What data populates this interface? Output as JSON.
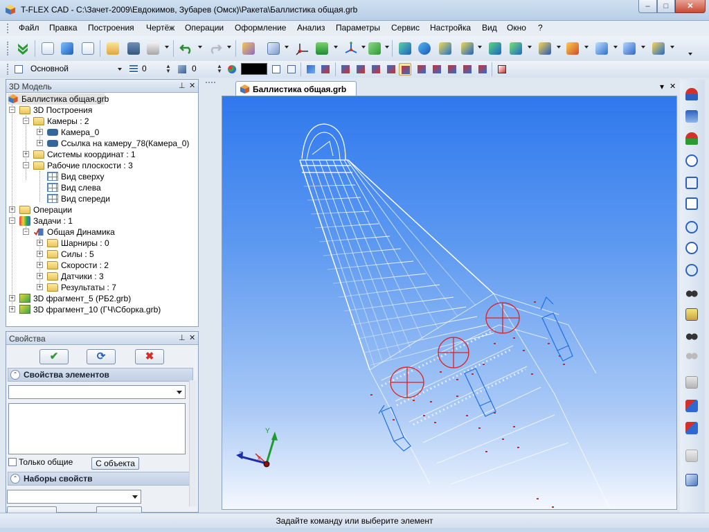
{
  "window": {
    "title": "T-FLEX CAD - C:\\Зачет-2009\\Евдокимов, Зубарев (Омск)\\Ракета\\Баллистика общая.grb",
    "minimize_glyph": "‒",
    "maximize_glyph": "□",
    "close_glyph": "✕"
  },
  "menu": [
    "Файл",
    "Правка",
    "Построения",
    "Чертёж",
    "Операции",
    "Оформление",
    "Анализ",
    "Параметры",
    "Сервис",
    "Настройка",
    "Вид",
    "Окно",
    "?"
  ],
  "toolbar2": {
    "layer_combo": "Основной",
    "level_value": "0",
    "priority_value": "0",
    "color_value": "#000000"
  },
  "model_panel": {
    "title": "3D Модель",
    "pin_glyph": "⊥",
    "close_glyph": "✕",
    "tree": [
      {
        "label": "Баллистика общая.grb",
        "icon": "document-icon"
      },
      {
        "label": "3D Построения",
        "icon": "folder-icon",
        "expander": "−"
      },
      {
        "label": "Камеры : 2",
        "icon": "folder-icon",
        "expander": "−"
      },
      {
        "label": "Камера_0",
        "icon": "camera-icon",
        "expander": "+"
      },
      {
        "label": "Ссылка на камеру_78(Камера_0)",
        "icon": "camera-icon",
        "expander": "+"
      },
      {
        "label": "Системы координат : 1",
        "icon": "folder-icon",
        "expander": "+"
      },
      {
        "label": "Рабочие плоскости : 3",
        "icon": "folder-icon",
        "expander": "−"
      },
      {
        "label": "Вид сверху",
        "icon": "workplane-icon"
      },
      {
        "label": "Вид слева",
        "icon": "workplane-icon"
      },
      {
        "label": "Вид спереди",
        "icon": "workplane-icon"
      },
      {
        "label": "Операции",
        "icon": "folder-icon",
        "expander": "+"
      },
      {
        "label": "Задачи : 1",
        "icon": "tasks-icon",
        "expander": "−"
      },
      {
        "label": "Общая Динамика",
        "icon": "dynamics-icon",
        "expander": "−"
      },
      {
        "label": "Шарниры : 0",
        "icon": "folder-icon",
        "expander": "+"
      },
      {
        "label": "Силы : 5",
        "icon": "folder-icon",
        "expander": "+"
      },
      {
        "label": "Скорости : 2",
        "icon": "folder-icon",
        "expander": "+"
      },
      {
        "label": "Датчики : 3",
        "icon": "folder-icon",
        "expander": "+"
      },
      {
        "label": "Результаты : 7",
        "icon": "folder-icon",
        "expander": "+"
      },
      {
        "label": "3D фрагмент_5 (РБ2.grb)",
        "icon": "fragment-icon",
        "expander": "+"
      },
      {
        "label": "3D фрагмент_10 (ГЧ\\Сборка.grb)",
        "icon": "fragment-icon",
        "expander": "+"
      }
    ]
  },
  "properties_panel": {
    "title": "Свойства",
    "ok_glyph": "✔",
    "refresh_glyph": "⟳",
    "cancel_glyph": "✖",
    "section_elements": "Свойства элементов",
    "section_sets": "Наборы свойств",
    "only_common_label": "Только общие",
    "from_object_button": "С объекта",
    "collapse_glyph": "⌃"
  },
  "document": {
    "tab_title": "Баллистика общая.grb",
    "tab_menu_glyph": "▾",
    "tab_close_glyph": "✕",
    "axes": {
      "x": "X",
      "y": "Y",
      "z": "Z"
    }
  },
  "status": {
    "message": "Задайте команду или выберите элемент"
  }
}
